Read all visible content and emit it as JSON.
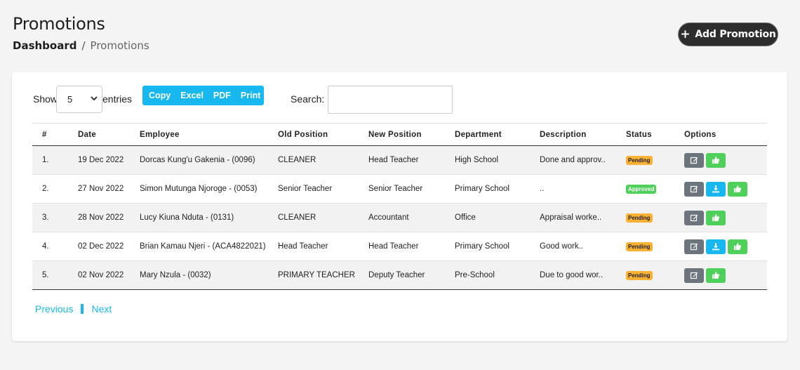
{
  "header": {
    "title": "Promotions",
    "breadcrumb_home": "Dashboard",
    "breadcrumb_sep": "/",
    "breadcrumb_current": "Promotions",
    "add_button": "Add Promotion"
  },
  "controls": {
    "show_label": "Show",
    "entries_value": "5",
    "entries_label": "entries",
    "export_buttons": [
      "Copy",
      "Excel",
      "PDF",
      "Print"
    ],
    "search_label": "Search:",
    "search_value": ""
  },
  "table": {
    "columns": [
      "#",
      "Date",
      "Employee",
      "Old Position",
      "New Position",
      "Department",
      "Description",
      "Status",
      "Options"
    ],
    "rows": [
      {
        "num": "1.",
        "date": "19 Dec 2022",
        "employee": "Dorcas Kung'u Gakenia - (0096)",
        "old_position": "CLEANER",
        "new_position": "Head Teacher",
        "department": "High School",
        "description": "Done and approv..",
        "status": "Pending"
      },
      {
        "num": "2.",
        "date": "27 Nov 2022",
        "employee": "Simon Mutunga Njoroge - (0053)",
        "old_position": "Senior Teacher",
        "new_position": "Senior Teacher",
        "department": "Primary School",
        "description": "..",
        "status": "Approved"
      },
      {
        "num": "3.",
        "date": "28 Nov 2022",
        "employee": "Lucy Kiuna Nduta - (0131)",
        "old_position": "CLEANER",
        "new_position": "Accountant",
        "department": "Office",
        "description": "Appraisal worke..",
        "status": "Pending"
      },
      {
        "num": "4.",
        "date": "02 Dec 2022",
        "employee": "Brian Kamau Njeri - (ACA4822021)",
        "old_position": "Head Teacher",
        "new_position": "Head Teacher",
        "department": "Primary School",
        "description": "Good work..",
        "status": "Pending"
      },
      {
        "num": "5.",
        "date": "02 Nov 2022",
        "employee": "Mary Nzula - (0032)",
        "old_position": "PRIMARY TEACHER",
        "new_position": "Deputy Teacher",
        "department": "Pre-School",
        "description": "Due to good wor..",
        "status": "Pending"
      }
    ]
  },
  "pagination": {
    "previous": "Previous",
    "next": "Next"
  },
  "colors": {
    "accent": "#16b8ef",
    "pending": "#f9b233",
    "approved": "#4ed05b",
    "edit": "#6c757d"
  }
}
